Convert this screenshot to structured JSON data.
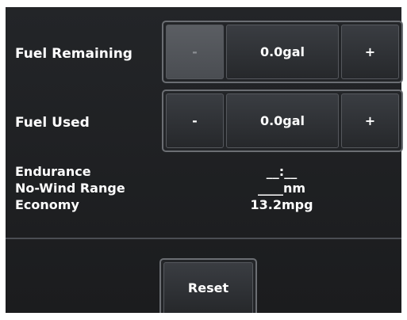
{
  "fuel_remaining": {
    "label": "Fuel Remaining",
    "minus_label": "-",
    "value": "0.0gal",
    "plus_label": "+",
    "minus_disabled": true
  },
  "fuel_used": {
    "label": "Fuel Used",
    "minus_label": "-",
    "value": "0.0gal",
    "plus_label": "+"
  },
  "info": {
    "endurance_label": "Endurance",
    "endurance_value": "__:__",
    "range_label": "No-Wind Range",
    "range_value": "____nm",
    "economy_label": "Economy",
    "economy_value": "13.2mpg"
  },
  "reset_label": "Reset",
  "colors": {
    "background": "#1f2022",
    "button": "#303236",
    "border": "#6b6e73",
    "disabled": "#55585d",
    "text": "#ffffff"
  }
}
